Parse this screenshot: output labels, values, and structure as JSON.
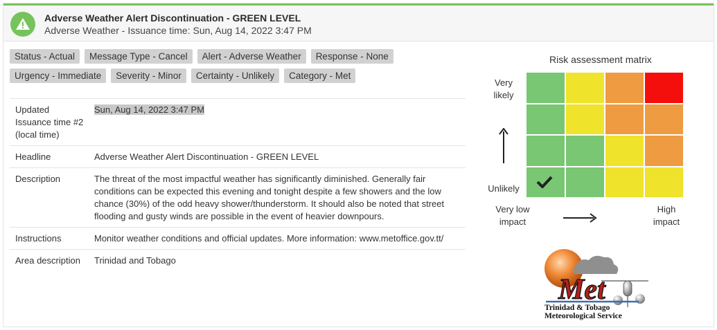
{
  "header": {
    "title": "Adverse Weather Alert Discontinuation - GREEN LEVEL",
    "subtitle": "Adverse Weather - Issuance time: Sun, Aug 14, 2022 3:47 PM",
    "icon": "warning-icon",
    "level_color": "#76c35c"
  },
  "tags": [
    [
      "Status - Actual",
      "Message Type - Cancel",
      "Alert - Adverse Weather",
      "Response - None"
    ],
    [
      "Urgency - Immediate",
      "Severity - Minor",
      "Certainty - Unlikely",
      "Category - Met"
    ]
  ],
  "info": {
    "updated": {
      "label": "Updated Issuance time #2 (local time)",
      "value": "Sun, Aug 14, 2022 3:47 PM"
    },
    "headline": {
      "label": "Headline",
      "value": "Adverse Weather Alert Discontinuation - GREEN LEVEL"
    },
    "description": {
      "label": "Description",
      "value": "The threat of the most impactful weather has significantly diminished. Generally fair conditions can be expected this evening and tonight despite a few showers and the low chance (30%) of the odd heavy shower/thunderstorm. It should also be noted that street flooding and gusty winds are possible in the event of heavier downpours."
    },
    "instructions": {
      "label": "Instructions",
      "value": "Monitor weather conditions and official updates. More information: www.metoffice.gov.tt/"
    },
    "area": {
      "label": "Area description",
      "value": "Trinidad and Tobago"
    }
  },
  "risk_matrix": {
    "title": "Risk assessment matrix",
    "likely_label": "Very likely",
    "unlikely_label": "Unlikely",
    "low_impact_label": "Very low impact",
    "high_impact_label": "High impact",
    "colors": {
      "green": "#79c673",
      "yellow": "#efe32b",
      "orange": "#ef9b41",
      "red": "#f50f0c"
    },
    "rows": [
      [
        "green",
        "yellow",
        "orange",
        "red"
      ],
      [
        "green",
        "yellow",
        "orange",
        "orange"
      ],
      [
        "green",
        "green",
        "yellow",
        "orange"
      ],
      [
        "green",
        "green",
        "yellow",
        "yellow"
      ]
    ],
    "selected": {
      "row": 3,
      "col": 0
    }
  },
  "logo": {
    "word": "Met",
    "line1": "Trinidad & Tobago",
    "line2": "Meteorological Service"
  }
}
